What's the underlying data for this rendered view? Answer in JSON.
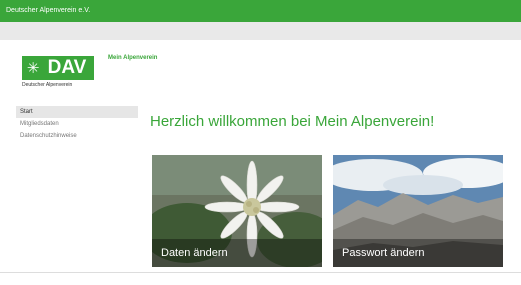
{
  "window": {
    "title": "Deutscher Alpenverein e.V."
  },
  "brand": {
    "logo_text": "DAV",
    "logo_subtitle": "Deutscher Alpenverein"
  },
  "nav": {
    "top_link": "Mein Alpenverein"
  },
  "sidebar": {
    "items": [
      {
        "label": "Start"
      },
      {
        "label": "Mitgliedsdaten"
      },
      {
        "label": "Datenschutzhinweise"
      }
    ]
  },
  "main": {
    "welcome": "Herzlich willkommen bei Mein Alpenverein!",
    "tiles": [
      {
        "label": "Daten ändern"
      },
      {
        "label": "Passwort ändern"
      }
    ]
  },
  "colors": {
    "accent": "#3aa63a",
    "toolbar": "#e9e9e9",
    "text_muted": "#777777"
  }
}
